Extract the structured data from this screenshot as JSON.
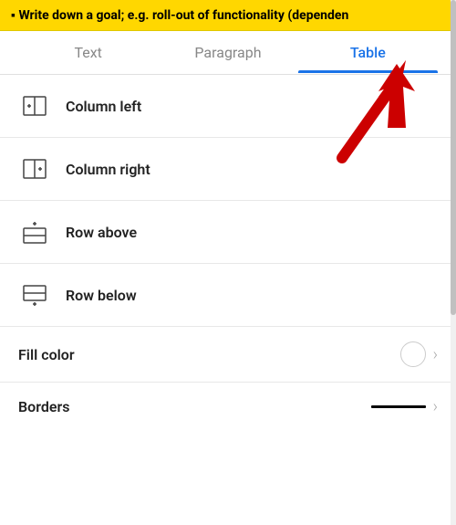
{
  "topbar": {
    "text": "▪ Write down a goal; e.g. roll-out of functionality (dependen"
  },
  "tabs": {
    "items": [
      {
        "id": "text",
        "label": "Text",
        "active": false
      },
      {
        "id": "paragraph",
        "label": "Paragraph",
        "active": false
      },
      {
        "id": "table",
        "label": "Table",
        "active": true
      }
    ]
  },
  "menu": {
    "items": [
      {
        "id": "column-left",
        "label": "Column left",
        "icon": "column-left-icon"
      },
      {
        "id": "column-right",
        "label": "Column right",
        "icon": "column-right-icon"
      },
      {
        "id": "row-above",
        "label": "Row above",
        "icon": "row-above-icon"
      },
      {
        "id": "row-below",
        "label": "Row below",
        "icon": "row-below-icon"
      },
      {
        "id": "fill-color",
        "label": "Fill color",
        "icon": null,
        "hasColorCircle": true,
        "hasChevron": true
      },
      {
        "id": "borders",
        "label": "Borders",
        "icon": null,
        "hasBorderLine": true,
        "hasChevron": true
      }
    ]
  },
  "arrow": {
    "visible": true,
    "color": "#cc0000"
  }
}
